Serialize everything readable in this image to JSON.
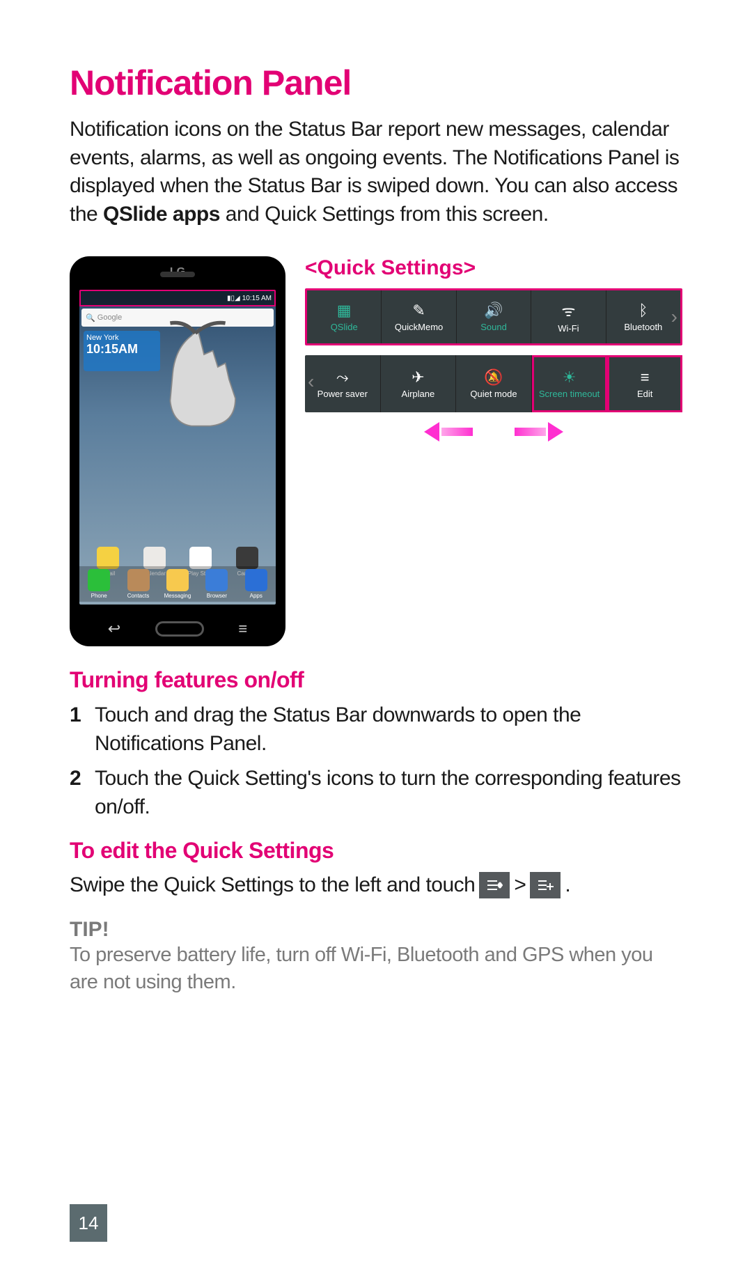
{
  "title": "Notification Panel",
  "intro_pre": "Notification icons on the Status Bar report new messages, calendar events, alarms, as well as ongoing events. The Notifications Panel is displayed when the Status Bar is swiped down. You can also access the ",
  "intro_bold": "QSlide apps",
  "intro_post": " and Quick Settings from this screen.",
  "phone": {
    "logo": "LG",
    "status_time": "10:15 AM",
    "search_placeholder": "Google",
    "weather_city": "New York",
    "weather_time": "10:15AM",
    "apps_row1": [
      {
        "label": "Email",
        "color": "#f5d142"
      },
      {
        "label": "Calendar",
        "color": "#eceae7"
      },
      {
        "label": "Play Store",
        "color": "#ffffff"
      },
      {
        "label": "Camera",
        "color": "#3a3a3a"
      }
    ],
    "apps_row2": [
      {
        "label": "Phone",
        "color": "#2bbf3a"
      },
      {
        "label": "Contacts",
        "color": "#b98a5a"
      },
      {
        "label": "Messaging",
        "color": "#f7c94e"
      },
      {
        "label": "Browser",
        "color": "#3b7dd8"
      },
      {
        "label": "Apps",
        "color": "#2b6fd6"
      }
    ]
  },
  "qs": {
    "heading": "<Quick Settings>",
    "row1": [
      {
        "label": "QSlide",
        "icon": "▦",
        "on": true
      },
      {
        "label": "QuickMemo",
        "icon": "✎"
      },
      {
        "label": "Sound",
        "icon": "🔊",
        "on": true
      },
      {
        "label": "Wi-Fi",
        "icon": "ᯤ"
      },
      {
        "label": "Bluetooth",
        "icon": "ᛒ"
      }
    ],
    "row2": [
      {
        "label": "Power saver",
        "icon": "⤳"
      },
      {
        "label": "Airplane",
        "icon": "✈"
      },
      {
        "label": "Quiet mode",
        "icon": "🔕"
      },
      {
        "label": "Screen timeout",
        "icon": "☀",
        "on": true,
        "hl": true
      },
      {
        "label": "Edit",
        "icon": "≡",
        "hl": true
      }
    ]
  },
  "sec1": {
    "heading": "Turning features on/off",
    "steps": [
      "Touch and drag the Status Bar downwards to open the Notifications Panel.",
      "Touch the Quick Setting's icons to turn the corresponding features on/off."
    ]
  },
  "sec2": {
    "heading": "To edit the Quick Settings",
    "line_pre": "Swipe the Quick Settings to the left and touch",
    "gt": ">",
    "period": "."
  },
  "tip": {
    "head": "TIP!",
    "body": "To preserve battery life, turn off Wi-Fi, Bluetooth and GPS when you are not using them."
  },
  "page_number": "14"
}
